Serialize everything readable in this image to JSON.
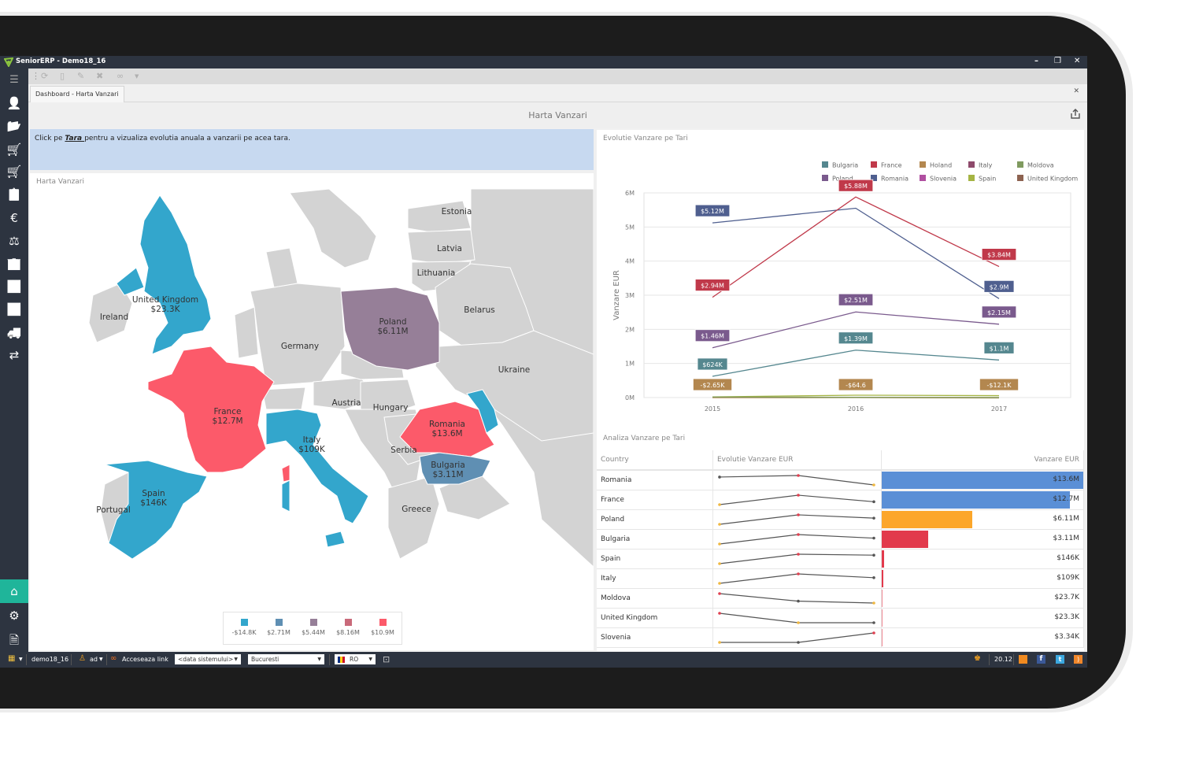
{
  "window": {
    "title": "SeniorERP - Demo18_16",
    "controls": [
      "minimize",
      "restore",
      "close"
    ]
  },
  "toolbar": {
    "icons": [
      "refresh-icon",
      "document-icon",
      "edit-icon",
      "delete-icon",
      "link-icon",
      "dropdown-icon"
    ]
  },
  "tabs": [
    {
      "label": "Dashboard - Harta Vanzari",
      "active": true
    }
  ],
  "sidebar": {
    "items": [
      {
        "name": "menu-icon",
        "glyph": "☰"
      },
      {
        "name": "user-desk-icon",
        "glyph": "👤"
      },
      {
        "name": "folder-open-icon",
        "glyph": "📂"
      },
      {
        "name": "cart-add-icon",
        "glyph": "🛒"
      },
      {
        "name": "cart-icon",
        "glyph": "🛒"
      },
      {
        "name": "clipboard-cart-icon",
        "glyph": "📋"
      },
      {
        "name": "currency-icon",
        "glyph": "€"
      },
      {
        "name": "scales-icon",
        "glyph": "⚖"
      },
      {
        "name": "building-icon",
        "glyph": "🏢"
      },
      {
        "name": "trend-chart-icon",
        "glyph": "📈"
      },
      {
        "name": "bar-chart-icon",
        "glyph": "📊"
      },
      {
        "name": "truck-icon",
        "glyph": "🚚"
      },
      {
        "name": "exchange-icon",
        "glyph": "⇄"
      }
    ],
    "bottom": [
      {
        "name": "home-icon",
        "glyph": "⌂",
        "active": true
      },
      {
        "name": "settings-gears-icon",
        "glyph": "⚙"
      },
      {
        "name": "report-search-icon",
        "glyph": "🗎"
      }
    ]
  },
  "dashboard": {
    "title": "Harta Vanzari",
    "note": {
      "prefix": "Click pe ",
      "link": "Tara ",
      "suffix": "pentru a vizualiza evolutia anuala a vanzarii pe acea tara."
    },
    "map": {
      "title": "Harta Vanzari",
      "highlighted": [
        {
          "country": "United Kingdom",
          "value": "$23.3K",
          "color": "#33a6cc"
        },
        {
          "country": "France",
          "value": "$12.7M",
          "color": "#fc5a6a"
        },
        {
          "country": "Spain",
          "value": "$146K",
          "color": "#33a6cc"
        },
        {
          "country": "Italy",
          "value": "$109K",
          "color": "#33a6cc"
        },
        {
          "country": "Poland",
          "value": "$6.11M",
          "color": "#967f98"
        },
        {
          "country": "Romania",
          "value": "$13.6M",
          "color": "#fc5a6a"
        },
        {
          "country": "Bulgaria",
          "value": "$3.11M",
          "color": "#5f8fb3"
        },
        {
          "country": "Moldova",
          "value": "",
          "color": "#33a6cc"
        }
      ],
      "other_labels": [
        "Ireland",
        "Portugal",
        "Germany",
        "Austria",
        "Hungary",
        "Serbia",
        "Greece",
        "Estonia",
        "Latvia",
        "Lithuania",
        "Belarus",
        "Ukraine"
      ],
      "legend": [
        {
          "label": "-$14.8K",
          "color": "#33a6cc"
        },
        {
          "label": "$2.71M",
          "color": "#5f8fb3"
        },
        {
          "label": "$5.44M",
          "color": "#967f98"
        },
        {
          "label": "$8.16M",
          "color": "#c96a7a"
        },
        {
          "label": "$10.9M",
          "color": "#fc5a6a"
        }
      ]
    },
    "chart_panel_title": "Evolutie Vanzare pe Tari",
    "grid": {
      "title": "Analiza Vanzare pe Tari",
      "columns": [
        "Country",
        "Evolutie Vanzare EUR",
        "Vanzare EUR"
      ],
      "rows": [
        {
          "country": "Romania",
          "value": "$13.6M",
          "num": 13.6,
          "bar_color": "#5a8fd6",
          "spark": [
            5.12,
            5.55,
            2.9
          ]
        },
        {
          "country": "France",
          "value": "$12.7M",
          "num": 12.7,
          "bar_color": "#5a8fd6",
          "spark": [
            2.94,
            5.88,
            3.84
          ]
        },
        {
          "country": "Poland",
          "value": "$6.11M",
          "num": 6.11,
          "bar_color": "#fca62a",
          "spark": [
            1.46,
            2.51,
            2.15
          ]
        },
        {
          "country": "Bulgaria",
          "value": "$3.11M",
          "num": 3.11,
          "bar_color": "#e23a4c",
          "spark": [
            0.624,
            1.39,
            1.1
          ]
        },
        {
          "country": "Spain",
          "value": "$146K",
          "num": 0.146,
          "bar_color": "#e23a4c",
          "spark": [
            0.02,
            0.07,
            0.065
          ]
        },
        {
          "country": "Italy",
          "value": "$109K",
          "num": 0.109,
          "bar_color": "#e23a4c",
          "spark": [
            0.01,
            0.06,
            0.04
          ]
        },
        {
          "country": "Moldova",
          "value": "$23.7K",
          "num": 0.0237,
          "bar_color": "#f08a96",
          "spark": [
            0.015,
            0.007,
            0.005
          ]
        },
        {
          "country": "United Kingdom",
          "value": "$23.3K",
          "num": 0.0233,
          "bar_color": "#f08a96",
          "spark": [
            0.016,
            0.004,
            0.004
          ]
        },
        {
          "country": "Slovenia",
          "value": "$3.34K",
          "num": 0.00334,
          "bar_color": "#f08a96",
          "spark": [
            0.001,
            0.001,
            0.003
          ]
        }
      ]
    }
  },
  "chart_data": {
    "type": "line",
    "title": "Evolutie Vanzare pe Tari",
    "xlabel": "",
    "ylabel": "Vanzare EUR",
    "x": [
      "2015",
      "2016",
      "2017"
    ],
    "ylim": [
      0,
      6000000
    ],
    "yticks": [
      "0M",
      "1M",
      "2M",
      "3M",
      "4M",
      "5M",
      "6M"
    ],
    "grid": true,
    "legend_position": "top-right",
    "legend": [
      {
        "name": "Bulgaria",
        "color": "#55878f"
      },
      {
        "name": "France",
        "color": "#c0394a"
      },
      {
        "name": "Holand",
        "color": "#b3874f"
      },
      {
        "name": "Italy",
        "color": "#8e4a6b"
      },
      {
        "name": "Moldova",
        "color": "#7f9a5f"
      },
      {
        "name": "Poland",
        "color": "#7a5a8d"
      },
      {
        "name": "Romania",
        "color": "#4f5f8f"
      },
      {
        "name": "Slovenia",
        "color": "#b04fa0"
      },
      {
        "name": "Spain",
        "color": "#a5b443"
      },
      {
        "name": "United Kingdom",
        "color": "#8d6250"
      }
    ],
    "series": [
      {
        "name": "Romania",
        "color": "#4f5f8f",
        "values": [
          5120000,
          5550000,
          2900000
        ],
        "labels": [
          "$5.12M",
          null,
          "$2.9M"
        ]
      },
      {
        "name": "France",
        "color": "#c0394a",
        "values": [
          2940000,
          5880000,
          3840000
        ],
        "labels": [
          "$2.94M",
          "$5.88M",
          "$3.84M"
        ]
      },
      {
        "name": "Poland",
        "color": "#7a5a8d",
        "values": [
          1460000,
          2510000,
          2150000
        ],
        "labels": [
          "$1.46M",
          "$2.51M",
          "$2.15M"
        ]
      },
      {
        "name": "Bulgaria",
        "color": "#55878f",
        "values": [
          624000,
          1390000,
          1100000
        ],
        "labels": [
          "$624K",
          "$1.39M",
          "$1.1M"
        ]
      },
      {
        "name": "Holand",
        "color": "#b3874f",
        "values": [
          -2650,
          -64.6,
          -12100
        ],
        "labels": [
          "-$2.65K",
          "-$64.6",
          "-$12.1K"
        ]
      },
      {
        "name": "Spain",
        "color": "#a5b443",
        "values": [
          20000,
          70000,
          56000
        ],
        "labels": [
          null,
          null,
          null
        ]
      },
      {
        "name": "Moldova",
        "color": "#7f9a5f",
        "values": [
          15000,
          7000,
          1700
        ],
        "labels": [
          null,
          null,
          null
        ]
      }
    ]
  },
  "statusbar": {
    "grid_menu": "grid-icon",
    "database": "demo18_16",
    "user": "ad",
    "link": "Acceseaza link",
    "date_select": "<data sistemului>",
    "city_select": "Bucuresti",
    "language": "RO",
    "time": "20.12"
  }
}
